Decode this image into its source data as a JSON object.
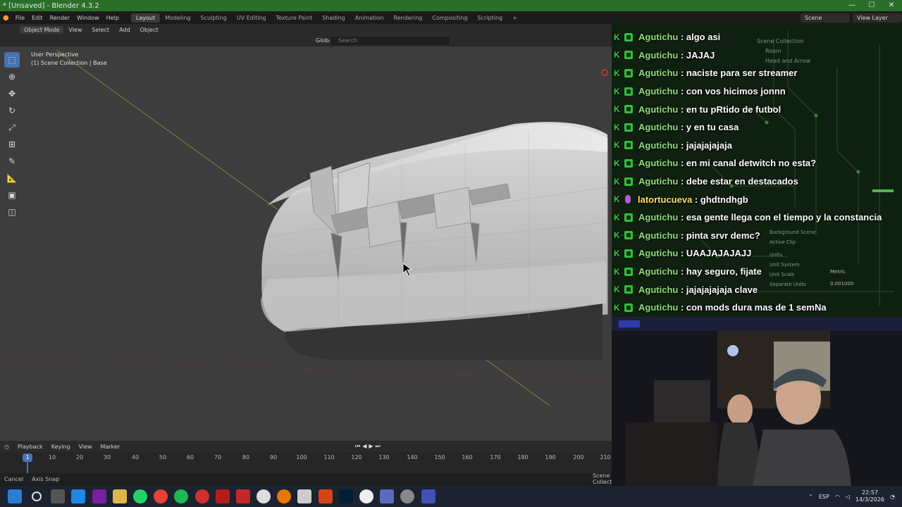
{
  "window": {
    "title": "* [Unsaved] - Blender 4.3.2",
    "minimize": "—",
    "maximize": "☐",
    "close": "✕"
  },
  "topbar": {
    "menu": [
      "File",
      "Edit",
      "Render",
      "Window",
      "Help"
    ],
    "workspaces": [
      "Layout",
      "Modeling",
      "Sculpting",
      "UV Editing",
      "Texture Paint",
      "Shading",
      "Animation",
      "Rendering",
      "Compositing",
      "Scripting"
    ],
    "active_workspace": "Layout",
    "add_workspace": "+",
    "scene": "Scene",
    "view_layer": "View Layer"
  },
  "viewport_header": {
    "mode": "Object Mode",
    "menus": [
      "View",
      "Select",
      "Add",
      "Object"
    ],
    "orientation": "Global",
    "search_placeholder": "Search"
  },
  "viewport": {
    "perspective": "User Perspective",
    "collection": "(1) Scene Collection | Base"
  },
  "timeline": {
    "menus": [
      "Playback",
      "Keying",
      "View",
      "Marker"
    ],
    "current_frame": "1",
    "ticks": [
      "10",
      "20",
      "30",
      "40",
      "50",
      "60",
      "70",
      "80",
      "90",
      "100",
      "110",
      "120",
      "130",
      "140",
      "150",
      "160",
      "170",
      "180",
      "190",
      "200",
      "210"
    ]
  },
  "statusbar": {
    "left": [
      "Cancel",
      "Axis Snap"
    ],
    "right": "Scene Collection"
  },
  "outliner": {
    "items": [
      "Scene Collection",
      "Room",
      "Head and Arrow"
    ],
    "properties": {
      "background_scene": "Background Scene",
      "active_clip": "Active Clip",
      "units": "Units",
      "unit_system_label": "Unit System",
      "unit_system_value": "Metric",
      "unit_scale_label": "Unit Scale",
      "unit_scale_value": "0.001000",
      "separate_units": "Separate Units"
    }
  },
  "chat": [
    {
      "user": "Agutichu",
      "text": "algo asi",
      "badge": "k"
    },
    {
      "user": "Agutichu",
      "text": "JAJAJ",
      "badge": "k"
    },
    {
      "user": "Agutichu",
      "text": "naciste para ser streamer",
      "badge": "k"
    },
    {
      "user": "Agutichu",
      "text": "con vos hicimos jonnn",
      "badge": "k"
    },
    {
      "user": "Agutichu",
      "text": "en tu pRtido de futbol",
      "badge": "k"
    },
    {
      "user": "Agutichu",
      "text": "y en tu casa",
      "badge": "k"
    },
    {
      "user": "Agutichu",
      "text": "jajajajajaja",
      "badge": "k"
    },
    {
      "user": "Agutichu",
      "text": "en mi canal detwitch no esta?",
      "badge": "k"
    },
    {
      "user": "Agutichu",
      "text": "debe estar en destacados",
      "badge": "k"
    },
    {
      "user": "latortucueva",
      "text": "ghdtndhgb",
      "badge": "mic"
    },
    {
      "user": "Agutichu",
      "text": "esa gente llega con el tiempo y la constancia",
      "badge": "k"
    },
    {
      "user": "Agutichu",
      "text": "pinta srvr demc?",
      "badge": "k"
    },
    {
      "user": "Agutichu",
      "text": "UAAJAJAJAJJ",
      "badge": "k"
    },
    {
      "user": "Agutichu",
      "text": "hay seguro, fijate",
      "badge": "k"
    },
    {
      "user": "Agutichu",
      "text": "jajajajajaja clave",
      "badge": "k"
    },
    {
      "user": "Agutichu",
      "text": "con mods dura mas de 1 semNa",
      "badge": "k"
    }
  ],
  "chat_separator": " : ",
  "taskbar": {
    "tray_lang": "ESP",
    "time": "22:57",
    "date": "14/3/2026"
  },
  "colors": {
    "blender_accent": "#4772b3",
    "titlebar": "#2b6e2b",
    "chat_user": "#8fe07a",
    "chat_user_alt": "#ffe066",
    "badge_green": "#2fc03a"
  }
}
